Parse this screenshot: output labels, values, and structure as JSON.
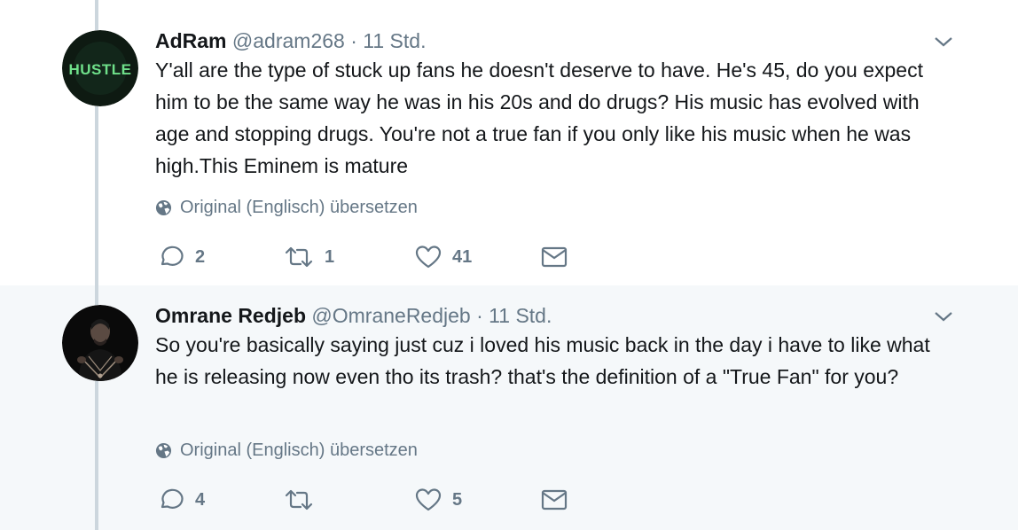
{
  "tweets": [
    {
      "avatar_text": "HUSTLE",
      "name": "AdRam",
      "handle": "@adram268",
      "separator": "·",
      "time": "11 Std.",
      "text": "Y'all are the type of stuck up fans he doesn't deserve to have. He's 45, do you expect him to be the same way he was in his 20s and do drugs? His music has evolved with age and stopping drugs. You're not a true fan if you only like his music when he was high.This Eminem is mature",
      "translate_label": "Original (Englisch) übersetzen",
      "replies": "2",
      "retweets": "1",
      "likes": "41"
    },
    {
      "name": "Omrane Redjeb",
      "handle": "@OmraneRedjeb",
      "separator": "·",
      "time": "11 Std.",
      "text": "So you're basically saying just cuz i loved his music back in the day i have to like what he is releasing now even tho its trash? that's the definition of a \"True Fan\" for you?",
      "translate_label": "Original (Englisch) übersetzen",
      "replies": "4",
      "retweets": "",
      "likes": "5"
    }
  ],
  "colors": {
    "text": "#14171a",
    "muted": "#657786",
    "thread_line": "#ccd6dd",
    "hover_bg": "#f5f8fa",
    "avatar_hustle_bg": "#0e1a12",
    "avatar_hustle_text": "#6fe08a"
  }
}
